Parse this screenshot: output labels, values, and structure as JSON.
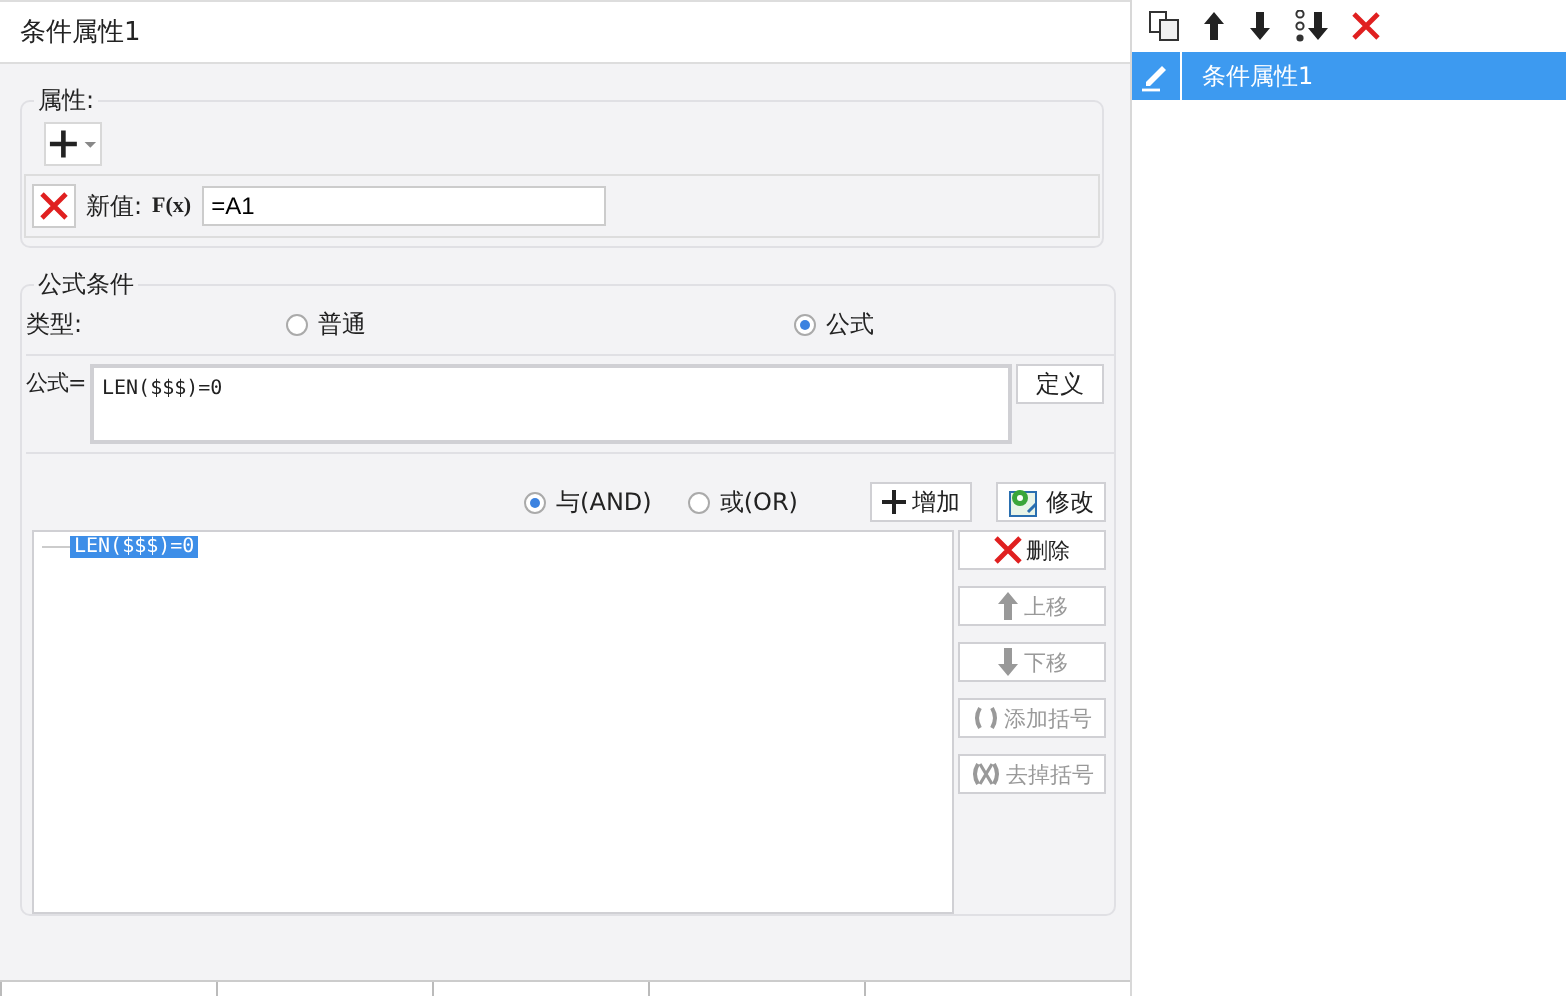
{
  "window": {
    "title": "条件属性1"
  },
  "attributes": {
    "legend": "属性:",
    "rows": [
      {
        "label": "新值:",
        "formula_button": "F(x)",
        "value": "=A1"
      }
    ]
  },
  "formula_condition": {
    "legend": "公式条件",
    "type_label": "类型:",
    "types": [
      {
        "label": "普通",
        "selected": false
      },
      {
        "label": "公式",
        "selected": true
      }
    ],
    "formula_label": "公式=",
    "formula": "LEN($$$)=0",
    "define_button": "定义",
    "logic": [
      {
        "label": "与(AND)",
        "selected": true
      },
      {
        "label": "或(OR)",
        "selected": false
      }
    ],
    "add_button": "增加",
    "modify_button": "修改",
    "conditions": [
      {
        "text": "LEN($$$)=0",
        "selected": true
      }
    ],
    "actions": [
      {
        "kind": "delete",
        "label": "删除",
        "disabled": false
      },
      {
        "kind": "up",
        "label": "上移",
        "disabled": true
      },
      {
        "kind": "down",
        "label": "下移",
        "disabled": true
      },
      {
        "kind": "addparen",
        "label": "添加括号",
        "disabled": true
      },
      {
        "kind": "removeparen",
        "label": "去掉括号",
        "disabled": true
      }
    ]
  },
  "sidebar": {
    "items": [
      {
        "label": "条件属性1",
        "selected": true
      }
    ]
  }
}
